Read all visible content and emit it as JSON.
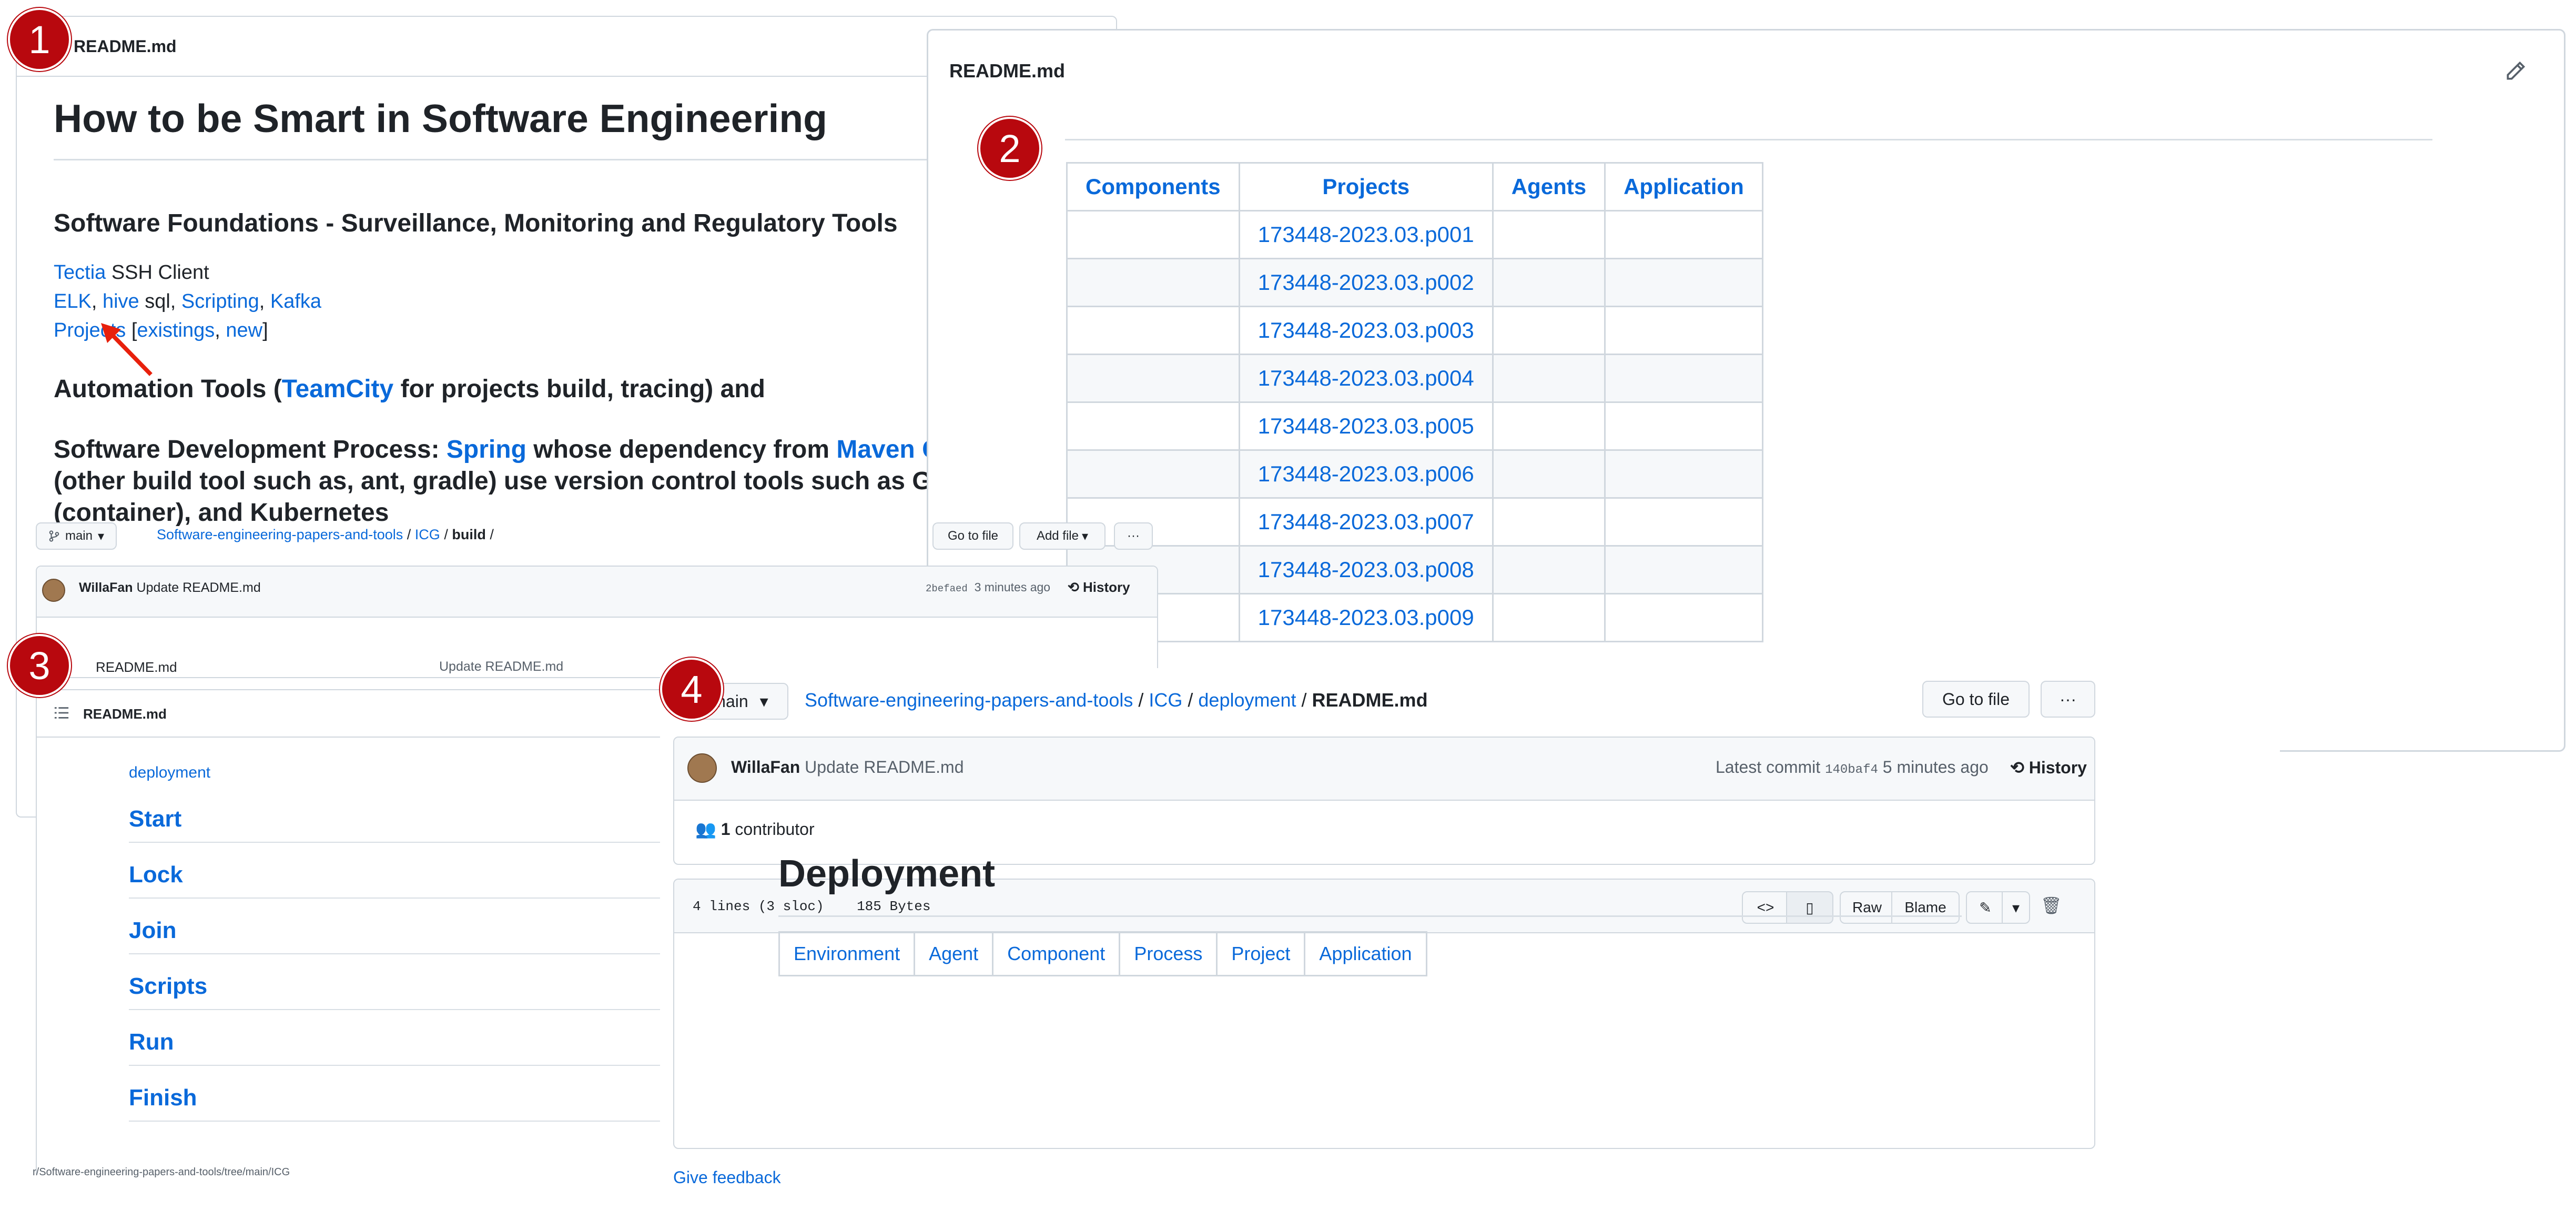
{
  "badges": [
    "1",
    "2",
    "3",
    "4"
  ],
  "panel1": {
    "file_name": "README.md",
    "title": "How to be Smart in Software Engineering",
    "section1": "Software Foundations - Surveillance, Monitoring and Regulatory Tools",
    "line_tectia": {
      "link": "Tectia",
      "text": " SSH Client"
    },
    "line_elk": {
      "elk": "ELK",
      "sep1": ", ",
      "hive": "hive",
      "sql": " sql, ",
      "scripting": "Scripting",
      "sep2": ", ",
      "kafka": "Kafka"
    },
    "line_projects": {
      "projects": "Projects",
      "open": " [",
      "existings": "existings",
      "comma": ", ",
      "new": "new",
      "close": "]"
    },
    "section2": {
      "pre": "Automation Tools (",
      "link": "TeamCity",
      "post": " for projects build, tracing) and"
    },
    "section3": {
      "pre": "Software Development Process: ",
      "spring": "Spring",
      "mid": " whose dependency from ",
      "maven": "Maven Centr",
      "line2": "(other build tool such as, ant, gradle) use version control tools such as Git, Do",
      "line3": "(container), and Kubernetes"
    }
  },
  "panel2": {
    "file_name": "README.md",
    "headers": [
      "Components",
      "Projects",
      "Agents",
      "Application"
    ],
    "projects": [
      "173448-2023.03.p001",
      "173448-2023.03.p002",
      "173448-2023.03.p003",
      "173448-2023.03.p004",
      "173448-2023.03.p005",
      "173448-2023.03.p006",
      "173448-2023.03.p007",
      "173448-2023.03.p008",
      "173448-2023.03.p009"
    ]
  },
  "panel3": {
    "branch": "main",
    "crumb": {
      "repo": "Software-engineering-papers-and-tools",
      "sep1": " / ",
      "icg": "ICG",
      "sep2": " / ",
      "build": "build",
      "sep3": " /"
    },
    "go_to_file": "Go to file",
    "add_file": "Add file",
    "more": "···",
    "commit_user": "WillaFan",
    "commit_msg": " Update README.md",
    "commit_hash": "2befaed",
    "commit_time": "3 minutes ago",
    "history": "History",
    "file_row": {
      "name": "README.md",
      "msg": "Update README.md"
    },
    "readme_name": "README.md",
    "deployment_link": "deployment",
    "nav_items": [
      "Start",
      "Lock",
      "Join",
      "Scripts",
      "Run",
      "Finish"
    ],
    "status_url": "r/Software-engineering-papers-and-tools/tree/main/ICG"
  },
  "panel4": {
    "branch": "main",
    "crumb": {
      "repo": "Software-engineering-papers-and-tools",
      "sep1": " / ",
      "icg": "ICG",
      "sep2": " / ",
      "deployment": "deployment",
      "sep3": " / ",
      "file": "README.md"
    },
    "go_to_file": "Go to file",
    "more": "···",
    "commit_user": "WillaFan",
    "commit_msg": " Update README.md",
    "latest_commit": "Latest commit ",
    "commit_hash": "140baf4",
    "commit_time": " 5 minutes ago",
    "history": "History",
    "contributors": {
      "count": "1",
      "label": " contributor"
    },
    "file_meta": {
      "lines": "4 lines (3 sloc)",
      "size": "185 Bytes"
    },
    "toolbar": {
      "raw": "Raw",
      "blame": "Blame"
    },
    "title": "Deployment",
    "table": [
      "Environment",
      "Agent",
      "Component",
      "Process",
      "Project",
      "Application"
    ],
    "feedback": "Give feedback"
  },
  "colors": {
    "link": "#0969da",
    "badge": "#b8080e",
    "border": "#d0d7de",
    "header_bg": "#f6f8fa"
  },
  "icons": [
    "pencil-icon",
    "branch-icon",
    "caret-down-icon",
    "history-icon",
    "list-icon",
    "people-icon",
    "code-icon",
    "file-icon",
    "trash-icon",
    "avatar",
    "red-arrow"
  ]
}
